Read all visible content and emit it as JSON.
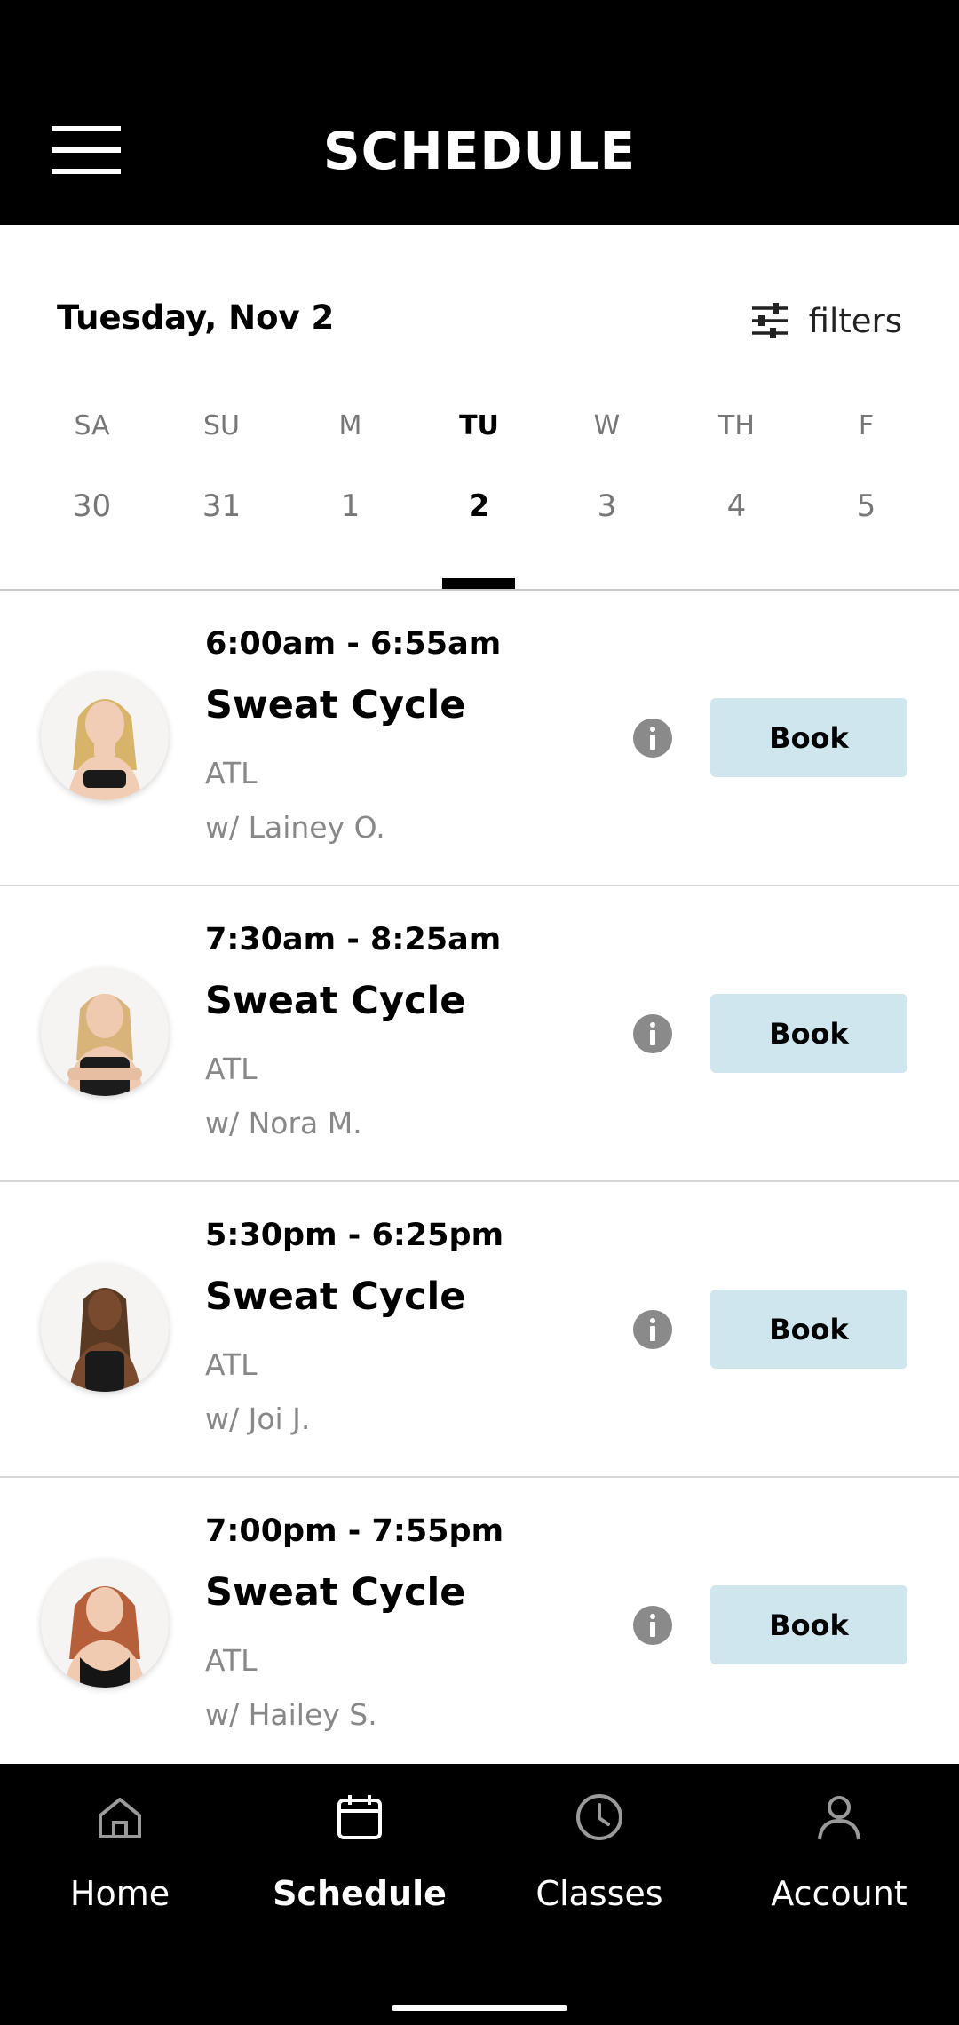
{
  "header": {
    "title": "SCHEDULE",
    "menu_icon": "hamburger-menu-icon"
  },
  "date_bar": {
    "selected_date": "Tuesday, Nov 2",
    "filters_label": "filters",
    "filters_icon": "sliders-icon"
  },
  "week": [
    {
      "name": "SA",
      "num": "30"
    },
    {
      "name": "SU",
      "num": "31"
    },
    {
      "name": "M",
      "num": "1"
    },
    {
      "name": "TU",
      "num": "2"
    },
    {
      "name": "W",
      "num": "3"
    },
    {
      "name": "TH",
      "num": "4"
    },
    {
      "name": "F",
      "num": "5"
    }
  ],
  "selected_day": "TU",
  "classes": [
    {
      "time": "6:00am - 6:55am",
      "name": "Sweat Cycle",
      "location": "ATL",
      "instructor": "w/ Lainey O.",
      "book_label": "Book"
    },
    {
      "time": "7:30am - 8:25am",
      "name": "Sweat Cycle",
      "location": "ATL",
      "instructor": "w/ Nora M.",
      "book_label": "Book"
    },
    {
      "time": "5:30pm - 6:25pm",
      "name": "Sweat Cycle",
      "location": "ATL",
      "instructor": "w/ Joi J.",
      "book_label": "Book"
    },
    {
      "time": "7:00pm - 7:55pm",
      "name": "Sweat Cycle",
      "location": "ATL",
      "instructor": "w/ Hailey S.",
      "book_label": "Book"
    }
  ],
  "tabs": [
    {
      "label": "Home",
      "icon": "home-icon"
    },
    {
      "label": "Schedule",
      "icon": "calendar-icon"
    },
    {
      "label": "Classes",
      "icon": "clock-icon"
    },
    {
      "label": "Account",
      "icon": "person-icon"
    }
  ],
  "active_tab": "Schedule",
  "colors": {
    "top_bar": "#000000",
    "book_button": "#cfe6ee",
    "muted_text": "#888888",
    "tab_bar": "#000000"
  }
}
